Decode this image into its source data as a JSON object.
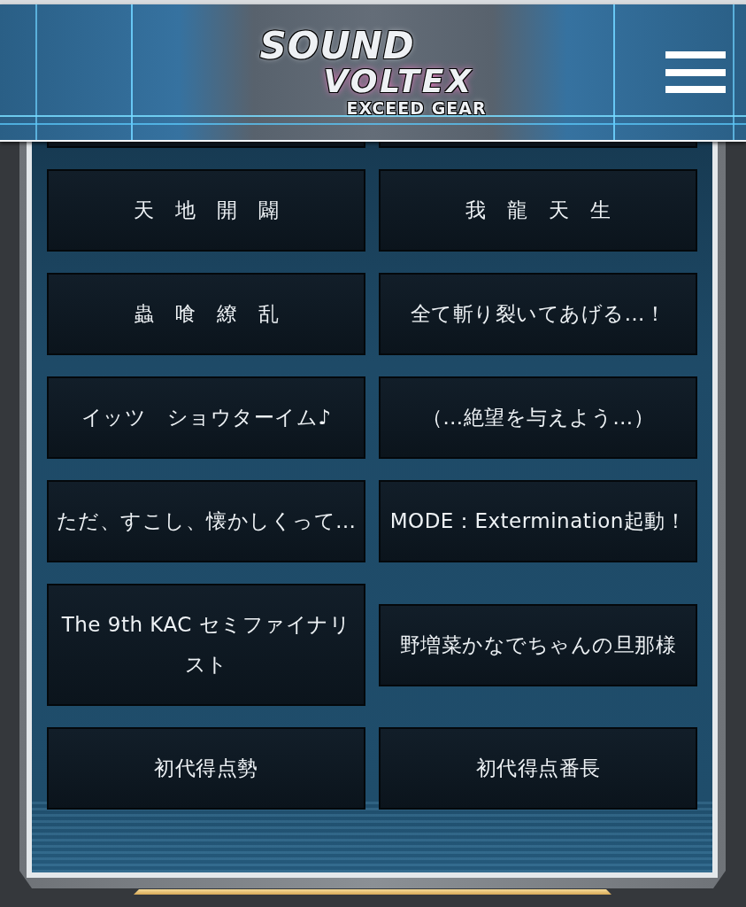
{
  "header": {
    "logo": {
      "line_1": "SOUND",
      "line_2": "VOLTEX",
      "subtitle": "EXCEED GEAR"
    }
  },
  "titles": [
    {
      "label": "天　地　開　闢"
    },
    {
      "label": "我　龍　天　生"
    },
    {
      "label": "蟲　喰　繚　乱"
    },
    {
      "label": "全て斬り裂いてあげる…！"
    },
    {
      "label": "イッツ　ショウターイム♪"
    },
    {
      "label": "（…絶望を与えよう…）"
    },
    {
      "label": "ただ、すこし、懐かしくって…"
    },
    {
      "label": "MODE：Extermination起動！"
    },
    {
      "label": "The 9th KAC セミファイナリスト"
    },
    {
      "label": "野増菜かなでちゃんの旦那様"
    },
    {
      "label": "初代得点勢"
    },
    {
      "label": "初代得点番長"
    }
  ]
}
